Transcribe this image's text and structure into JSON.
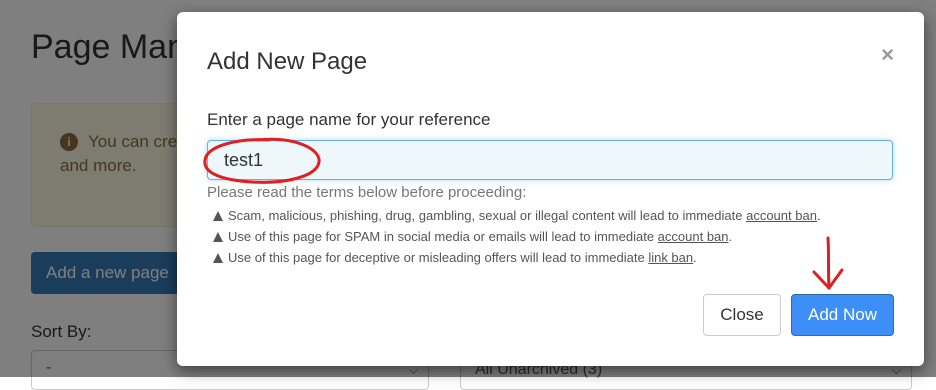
{
  "background": {
    "page_title": "Page Manager",
    "alert_text": "You can create powerful Page and more.",
    "add_button_label": "Add a new page",
    "sort_label": "Sort By:",
    "sort_select_value": "-",
    "filter_select_value": "All Unarchived (3)"
  },
  "modal": {
    "title": "Add New Page",
    "close_x": "×",
    "field_label": "Enter a page name for your reference",
    "input_value": "test1",
    "terms_intro": "Please read the terms below before proceeding:",
    "terms": [
      {
        "text": "Scam, malicious, phishing, drug, gambling, sexual or illegal content will lead to immediate ",
        "link": "account ban",
        "end": "."
      },
      {
        "text": "Use of this page for SPAM in social media or emails will lead to immediate ",
        "link": "account ban",
        "end": "."
      },
      {
        "text": "Use of this page for deceptive or misleading offers will lead to immediate ",
        "link": "link ban",
        "end": "."
      }
    ],
    "close_button": "Close",
    "add_button": "Add Now"
  },
  "colors": {
    "primary": "#3e8ef7",
    "annotation": "#e02020",
    "overlay": "rgba(0,0,0,0.5)"
  },
  "icons": [
    "info-icon",
    "warning-icon",
    "chevron-down-icon",
    "close-icon",
    "down-arrow-annotation"
  ]
}
